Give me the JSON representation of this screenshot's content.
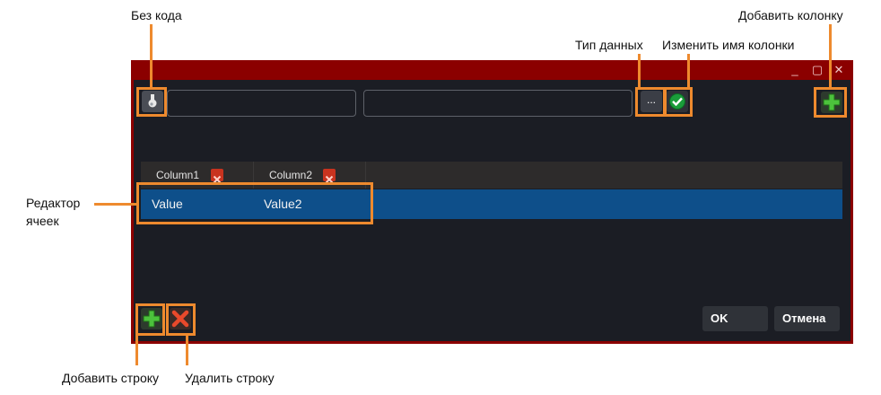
{
  "callouts": {
    "no_code": "Без кода",
    "data_type": "Тип данных",
    "rename_column": "Изменить имя колонки",
    "add_column": "Добавить колонку",
    "cell_editor_line1": "Редактор",
    "cell_editor_line2": "ячеек",
    "add_row": "Добавить строку",
    "delete_row": "Удалить строку"
  },
  "window": {
    "minimize": "_",
    "maximize": "▢",
    "close": "✕"
  },
  "toolbar": {
    "name_value": "",
    "value_value": "",
    "dots_label": "..."
  },
  "grid": {
    "columns": [
      "Column1",
      "Column2"
    ],
    "rows": [
      [
        "Value",
        "Value2"
      ]
    ]
  },
  "footer": {
    "ok_label": "OK",
    "cancel_label": "Отмена"
  },
  "colors": {
    "frame": "#8b0000",
    "highlight": "#ee8a2e",
    "row_selected": "#0e4f8a",
    "client": "#1b1d24"
  }
}
